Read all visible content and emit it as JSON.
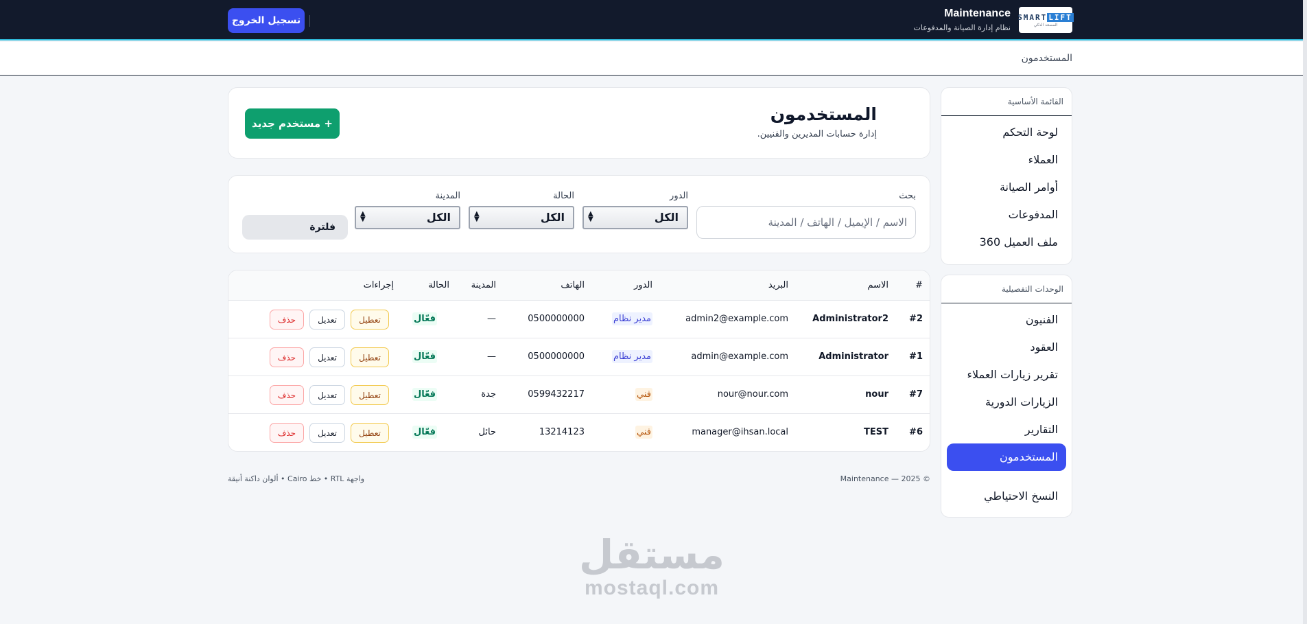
{
  "brand": {
    "logo_main_a": "SMART",
    "logo_main_b": "LIFT",
    "logo_sub": "المصعد الذكي",
    "title": "Maintenance",
    "subtitle": "نظام إدارة الصيانة والمدفوعات"
  },
  "topbar": {
    "logout_label": "تسجيل الخروج"
  },
  "breadcrumb": "المستخدمون",
  "sidebar": {
    "main_heading": "القائمة الأساسية",
    "main_items": [
      "لوحة التحكم",
      "العملاء",
      "أوامر الصيانة",
      "المدفوعات",
      "ملف العميل 360"
    ],
    "detail_heading": "الوحدات التفصيلية",
    "detail_items": [
      "الفنيون",
      "العقود",
      "تقرير زيارات العملاء",
      "الزيارات الدورية",
      "التقارير",
      "المستخدمون",
      "النسخ الاحتياطي"
    ],
    "active_item": "المستخدمون"
  },
  "header": {
    "title": "المستخدمون",
    "subtitle": "إدارة حسابات المديرين والفنيين.",
    "new_user_label": "+ مستخدم جديد"
  },
  "filters": {
    "search_label": "بحث",
    "search_placeholder": "الاسم / الإيميل / الهاتف / المدينة",
    "search_value": "",
    "role_label": "الدور",
    "role_value": "الكل",
    "status_label": "الحالة",
    "status_value": "الكل",
    "city_label": "المدينة",
    "city_value": "الكل",
    "filter_button": "فلترة"
  },
  "table": {
    "columns": [
      "#",
      "الاسم",
      "البريد",
      "الدور",
      "الهاتف",
      "المدينة",
      "الحالة",
      "إجراءات"
    ],
    "rows": [
      {
        "id": "#2",
        "name": "Administrator2",
        "email": "admin2@example.com",
        "role": "مدير نظام",
        "role_type": "admin",
        "phone": "0500000000",
        "city": "—",
        "status": "فعّال"
      },
      {
        "id": "#1",
        "name": "Administrator",
        "email": "admin@example.com",
        "role": "مدير نظام",
        "role_type": "admin",
        "phone": "0500000000",
        "city": "—",
        "status": "فعّال"
      },
      {
        "id": "#7",
        "name": "nour",
        "email": "nour@nour.com",
        "role": "فني",
        "role_type": "tech",
        "phone": "0599432217",
        "city": "جدة",
        "status": "فعّال"
      },
      {
        "id": "#6",
        "name": "TEST",
        "email": "manager@ihsan.local",
        "role": "فني",
        "role_type": "tech",
        "phone": "13214123",
        "city": "حائل",
        "status": "فعّال"
      }
    ],
    "actions": {
      "disable": "تعطيل",
      "edit": "تعديل",
      "delete": "حذف"
    }
  },
  "footer": {
    "copyright": "© 2025 — Maintenance",
    "note": "واجهة RTL • خط Cairo • ألوان داكنة أنيقة"
  },
  "watermark": {
    "arabic": "مستقل",
    "latin": "mostaql.com"
  },
  "colors": {
    "topbar_bg": "#121a2c",
    "accent_blue": "#3b4ff0",
    "accent_green": "#0e9f6e",
    "page_bg": "#f4f6f9"
  }
}
